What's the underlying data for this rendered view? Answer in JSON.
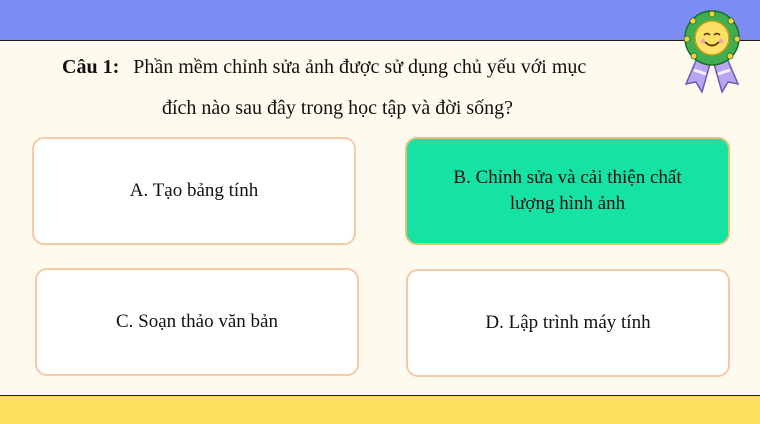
{
  "question": {
    "label": "Câu 1:",
    "text_line1": "Phần mềm chỉnh sửa ảnh được sử dụng chủ yếu với mục",
    "text_line2": "đích nào sau đây trong học tập và đời sống?"
  },
  "options": [
    {
      "id": "A",
      "text": "A. Tạo bảng tính",
      "selected": false
    },
    {
      "id": "B",
      "text": "B. Chỉnh sửa và cải thiện chất lượng hình ảnh",
      "selected": true
    },
    {
      "id": "C",
      "text": "C. Soạn thảo văn bản",
      "selected": false
    },
    {
      "id": "D",
      "text": "D. Lập trình máy tính",
      "selected": false
    }
  ],
  "colors": {
    "top_bar": "#7b8cf2",
    "bottom_bar": "#fedf5e",
    "background": "#fefbee",
    "selected_option": "#16e3a3",
    "option_border": "#f7c9a6"
  },
  "icons": {
    "medal": "smiling-medal-icon"
  }
}
